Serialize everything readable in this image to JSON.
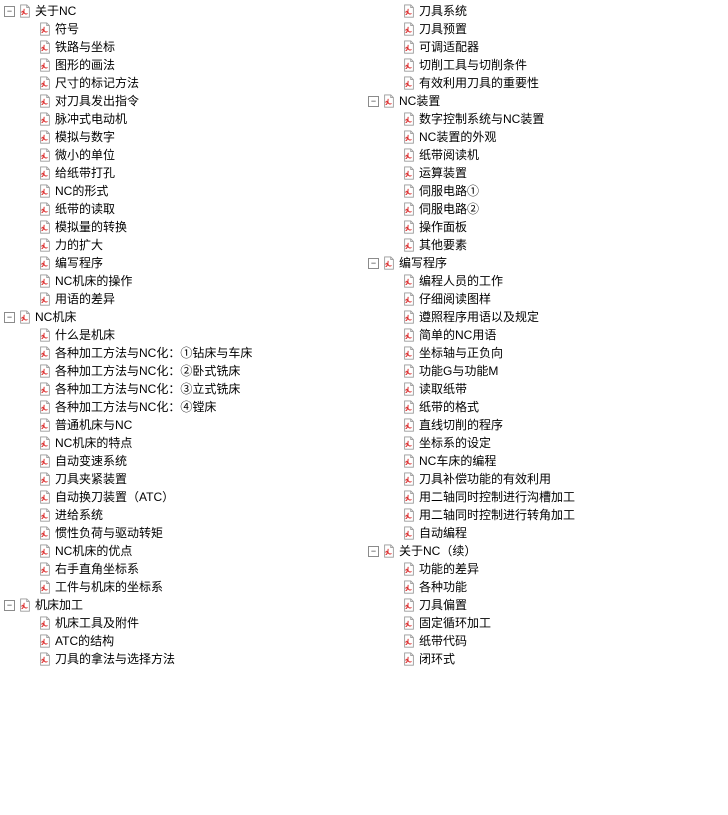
{
  "columns": [
    {
      "nodes": [
        {
          "indent": 0,
          "toggle": "−",
          "label": "关于NC"
        },
        {
          "indent": 1,
          "label": "符号"
        },
        {
          "indent": 1,
          "label": "铁路与坐标"
        },
        {
          "indent": 1,
          "label": "图形的画法"
        },
        {
          "indent": 1,
          "label": "尺寸的标记方法"
        },
        {
          "indent": 1,
          "label": "对刀具发出指令"
        },
        {
          "indent": 1,
          "label": "脉冲式电动机"
        },
        {
          "indent": 1,
          "label": "模拟与数字"
        },
        {
          "indent": 1,
          "label": "微小的单位"
        },
        {
          "indent": 1,
          "label": "给纸带打孔"
        },
        {
          "indent": 1,
          "label": "NC的形式"
        },
        {
          "indent": 1,
          "label": "纸带的读取"
        },
        {
          "indent": 1,
          "label": "模拟量的转换"
        },
        {
          "indent": 1,
          "label": "力的扩大"
        },
        {
          "indent": 1,
          "label": "编写程序"
        },
        {
          "indent": 1,
          "label": "NC机床的操作"
        },
        {
          "indent": 1,
          "label": "用语的差异"
        },
        {
          "indent": 0,
          "toggle": "−",
          "label": "NC机床"
        },
        {
          "indent": 1,
          "label": "什么是机床"
        },
        {
          "indent": 1,
          "label": "各种加工方法与NC化：①钻床与车床"
        },
        {
          "indent": 1,
          "label": "各种加工方法与NC化：②卧式铣床"
        },
        {
          "indent": 1,
          "label": "各种加工方法与NC化：③立式铣床"
        },
        {
          "indent": 1,
          "label": "各种加工方法与NC化：④镗床"
        },
        {
          "indent": 1,
          "label": "普通机床与NC"
        },
        {
          "indent": 1,
          "label": "NC机床的特点"
        },
        {
          "indent": 1,
          "label": "自动变速系统"
        },
        {
          "indent": 1,
          "label": "刀具夹紧装置"
        },
        {
          "indent": 1,
          "label": "自动换刀装置（ATC）"
        },
        {
          "indent": 1,
          "label": "进给系统"
        },
        {
          "indent": 1,
          "label": "惯性负荷与驱动转矩"
        },
        {
          "indent": 1,
          "label": "NC机床的优点"
        },
        {
          "indent": 1,
          "label": "右手直角坐标系"
        },
        {
          "indent": 1,
          "label": "工件与机床的坐标系"
        },
        {
          "indent": 0,
          "toggle": "−",
          "label": "机床加工"
        },
        {
          "indent": 1,
          "label": "机床工具及附件"
        },
        {
          "indent": 1,
          "label": "ATC的结构"
        },
        {
          "indent": 1,
          "label": "刀具的拿法与选择方法"
        }
      ]
    },
    {
      "nodes": [
        {
          "indent": 1,
          "label": "刀具系统"
        },
        {
          "indent": 1,
          "label": "刀具预置"
        },
        {
          "indent": 1,
          "label": "可调适配器"
        },
        {
          "indent": 1,
          "label": "切削工具与切削条件"
        },
        {
          "indent": 1,
          "label": "有效利用刀具的重要性"
        },
        {
          "indent": 0,
          "toggle": "−",
          "label": "NC装置"
        },
        {
          "indent": 1,
          "label": "数字控制系统与NC装置"
        },
        {
          "indent": 1,
          "label": "NC装置的外观"
        },
        {
          "indent": 1,
          "label": "纸带阅读机"
        },
        {
          "indent": 1,
          "label": "运算装置"
        },
        {
          "indent": 1,
          "label": "伺服电路①"
        },
        {
          "indent": 1,
          "label": "伺服电路②"
        },
        {
          "indent": 1,
          "label": "操作面板"
        },
        {
          "indent": 1,
          "label": "其他要素"
        },
        {
          "indent": 0,
          "toggle": "−",
          "label": "编写程序"
        },
        {
          "indent": 1,
          "label": "编程人员的工作"
        },
        {
          "indent": 1,
          "label": "仔细阅读图样"
        },
        {
          "indent": 1,
          "label": "遵照程序用语以及规定"
        },
        {
          "indent": 1,
          "label": "简单的NC用语"
        },
        {
          "indent": 1,
          "label": "坐标轴与正负向"
        },
        {
          "indent": 1,
          "label": "功能G与功能M"
        },
        {
          "indent": 1,
          "label": "读取纸带"
        },
        {
          "indent": 1,
          "label": "纸带的格式"
        },
        {
          "indent": 1,
          "label": "直线切削的程序"
        },
        {
          "indent": 1,
          "label": "坐标系的设定"
        },
        {
          "indent": 1,
          "label": "NC车床的编程"
        },
        {
          "indent": 1,
          "label": "刀具补偿功能的有效利用"
        },
        {
          "indent": 1,
          "label": "用二轴同时控制进行沟槽加工"
        },
        {
          "indent": 1,
          "label": "用二轴同时控制进行转角加工"
        },
        {
          "indent": 1,
          "label": "自动编程"
        },
        {
          "indent": 0,
          "toggle": "−",
          "label": "关于NC（续）"
        },
        {
          "indent": 1,
          "label": "功能的差异"
        },
        {
          "indent": 1,
          "label": "各种功能"
        },
        {
          "indent": 1,
          "label": "刀具偏置"
        },
        {
          "indent": 1,
          "label": "固定循环加工"
        },
        {
          "indent": 1,
          "label": "纸带代码"
        },
        {
          "indent": 1,
          "label": "闭环式"
        }
      ]
    }
  ]
}
